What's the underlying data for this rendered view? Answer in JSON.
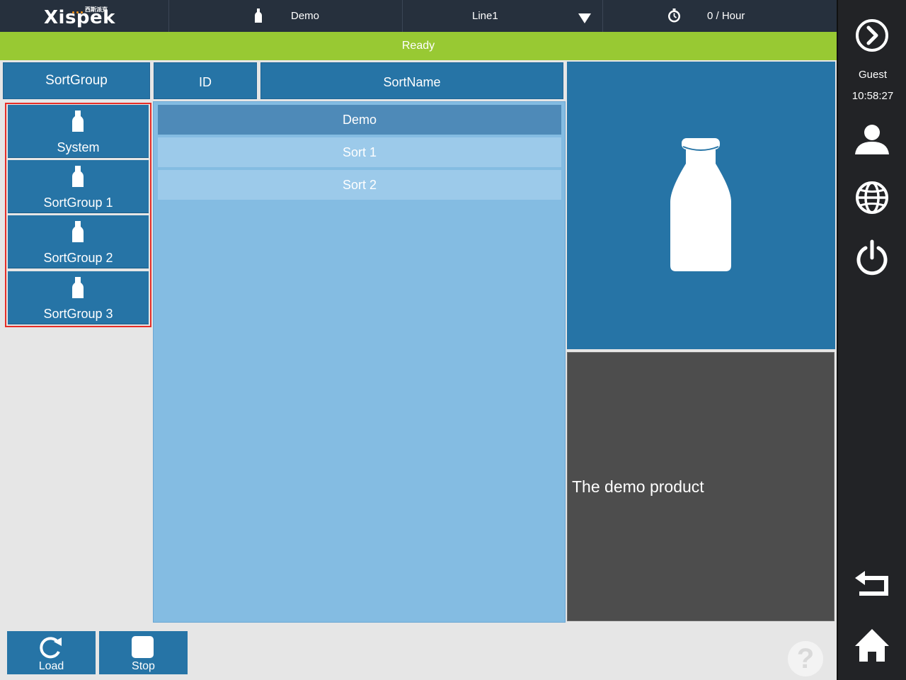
{
  "topbar": {
    "brand": "Xispek",
    "brand_sub": "西斯派克",
    "product": "Demo",
    "line": "Line1",
    "rate": "0 / Hour"
  },
  "status": {
    "text": "Ready"
  },
  "sort_groups": {
    "header": "SortGroup",
    "items": [
      {
        "label": "System"
      },
      {
        "label": "SortGroup 1"
      },
      {
        "label": "SortGroup 2"
      },
      {
        "label": "SortGroup 3"
      }
    ]
  },
  "sort_table": {
    "columns": [
      "ID",
      "SortName"
    ],
    "rows": [
      {
        "name": "Demo",
        "selected": true
      },
      {
        "name": "Sort 1",
        "selected": false
      },
      {
        "name": "Sort 2",
        "selected": false
      }
    ]
  },
  "product_description": "The demo product",
  "buttons": {
    "load": "Load",
    "stop": "Stop"
  },
  "help": {
    "symbol": "?"
  },
  "sidebar": {
    "user": "Guest",
    "time": "10:58:27"
  },
  "colors": {
    "accent_blue": "#2674a6",
    "status_green": "#98c933",
    "selection_outline": "#e52d27",
    "topbar_dark": "#26303d"
  },
  "icons": [
    "bottle-icon",
    "dropdown-arrow-icon",
    "clock-icon",
    "forward-icon",
    "user-icon",
    "globe-icon",
    "power-icon",
    "back-icon",
    "home-icon",
    "reload-icon",
    "stop-icon",
    "help-icon"
  ]
}
